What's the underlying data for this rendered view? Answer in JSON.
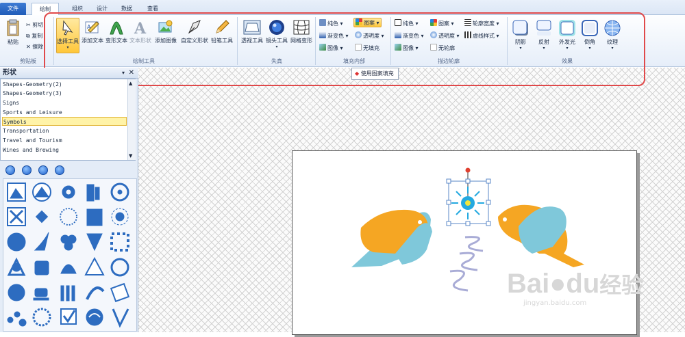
{
  "tabs": {
    "file": "文件",
    "draw": "绘制",
    "t2": "组织",
    "t3": "设计",
    "t4": "数据",
    "t5": "查看"
  },
  "clipboard": {
    "paste": "粘贴",
    "cut": "剪切",
    "copy": "复制",
    "erase": "擦除",
    "group": "剪贴板"
  },
  "draw_tools": {
    "select": "选择工具",
    "add_text": "添加文本",
    "transform_text": "变形文本",
    "text_shape": "文本形状",
    "add_image": "添加图像",
    "custom_shape": "自定义形状",
    "pencil": "铅笔工具",
    "group": "绘制工具"
  },
  "focus": {
    "perspective": "透视工具",
    "lens": "镜头工具",
    "mesh": "网格变形",
    "group": "失真"
  },
  "fill": {
    "solid": "纯色",
    "gradient": "渐变色",
    "image": "图像",
    "pattern": "图案",
    "transparency": "透明度",
    "none": "无填充",
    "group": "填充内部"
  },
  "stroke": {
    "solid": "纯色",
    "gradient": "渐变色",
    "image": "图像",
    "pattern": "图案",
    "transparency": "透明度",
    "none": "无轮廓",
    "width": "轮廓宽度",
    "style": "虚线样式",
    "group": "描边轮廓"
  },
  "effects": {
    "shadow": "阴影",
    "reflect": "反射",
    "glow": "外发光",
    "bevel": "倒角",
    "texture": "纹理",
    "group": "效果"
  },
  "tooltip": "使用图案填充",
  "panel": {
    "title": "形状",
    "categories": [
      "Shapes-Geometry(2)",
      "Shapes-Geometry(3)",
      "Signs",
      "Sports and Leisure",
      "Symbols",
      "Transportation",
      "Travel and Tourism",
      "Wines and Brewing"
    ],
    "selected": "Symbols"
  },
  "watermark": {
    "brand": "Bai",
    "paw": "du",
    "cn": "经验",
    "url": "jingyan.baidu.com"
  },
  "colors": {
    "accent": "#e0494a",
    "bird_orange": "#f5a623",
    "bird_blue": "#7fc8da",
    "shape_blue": "#2d6cc0"
  }
}
